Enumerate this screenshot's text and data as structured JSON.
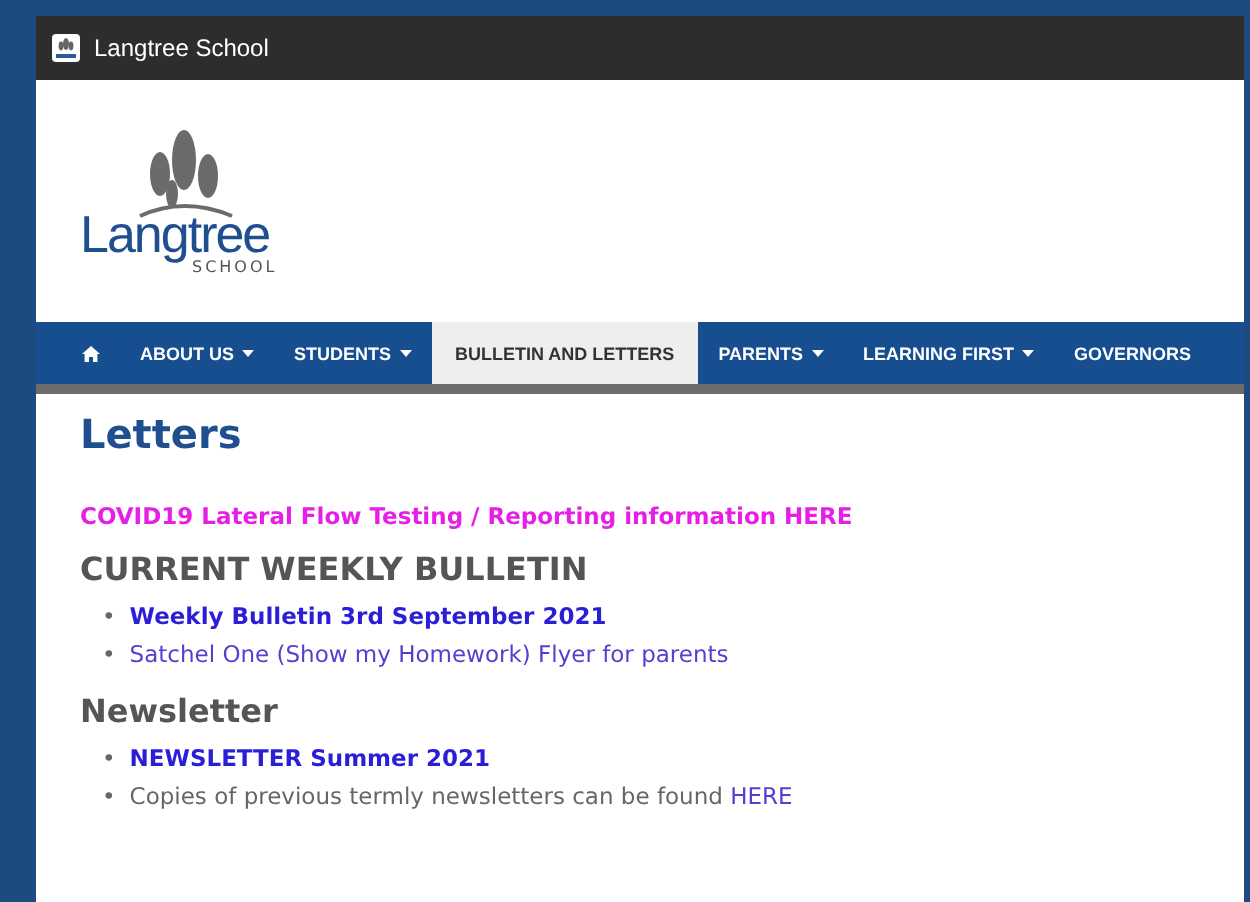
{
  "window": {
    "title": "Langtree School"
  },
  "logo": {
    "name": "Langtree",
    "subtitle": "SCHOOL"
  },
  "nav": [
    {
      "kind": "home",
      "selected": false
    },
    {
      "kind": "item",
      "label": "ABOUT US",
      "dropdown": true,
      "selected": false
    },
    {
      "kind": "item",
      "label": "STUDENTS",
      "dropdown": true,
      "selected": false
    },
    {
      "kind": "item",
      "label": "BULLETIN AND LETTERS",
      "dropdown": false,
      "selected": true
    },
    {
      "kind": "item",
      "label": "PARENTS",
      "dropdown": true,
      "selected": false
    },
    {
      "kind": "item",
      "label": "LEARNING FIRST",
      "dropdown": true,
      "selected": false
    },
    {
      "kind": "item",
      "label": "GOVERNORS",
      "dropdown": false,
      "selected": false
    }
  ],
  "page_title": "Letters",
  "notice": "COVID19 Lateral Flow Testing / Reporting information HERE",
  "sections": [
    {
      "heading": "CURRENT WEEKLY BULLETIN",
      "items": [
        {
          "kind": "bold-link",
          "bullet": "•",
          "text": "Weekly Bulletin 3rd September 2021"
        },
        {
          "kind": "link",
          "bullet": "•",
          "text": "Satchel One (Show my Homework) Flyer for parents"
        }
      ]
    },
    {
      "heading": "Newsletter",
      "items": [
        {
          "kind": "bold-link",
          "bullet": "•",
          "text": "NEWSLETTER Summer 2021"
        },
        {
          "kind": "text-with-link",
          "bullet": "•",
          "text": "Copies of previous termly newsletters can be found",
          "link": "HERE"
        }
      ]
    }
  ]
}
